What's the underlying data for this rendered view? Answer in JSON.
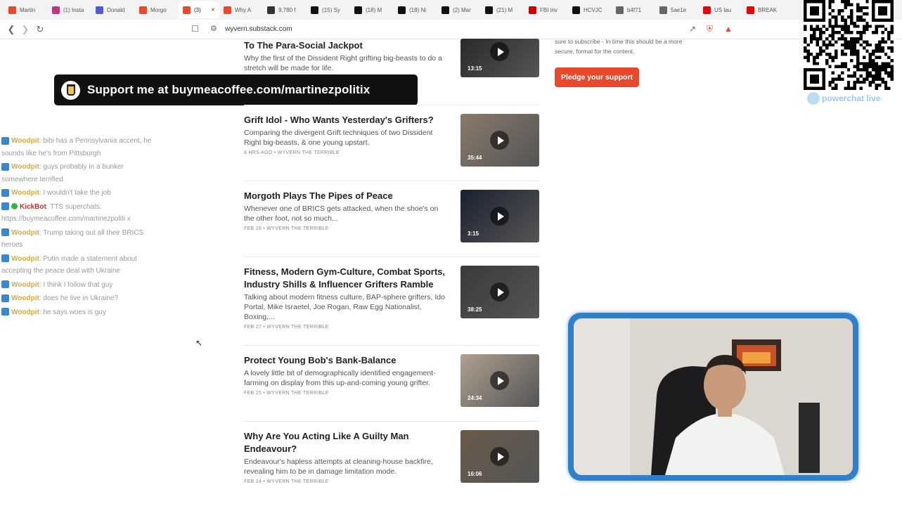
{
  "tabs": [
    {
      "label": "Martin",
      "color": "#e8492c"
    },
    {
      "label": "(1) Insta",
      "color": "#c13584"
    },
    {
      "label": "Donald",
      "color": "#4c5cd4"
    },
    {
      "label": "Morgo",
      "color": "#e8492c"
    },
    {
      "label": "(3)",
      "color": "#e8492c",
      "active": true
    },
    {
      "label": "Why A",
      "color": "#e8492c"
    },
    {
      "label": "9,780 f",
      "color": "#333"
    },
    {
      "label": "(15) Sy",
      "color": "#111"
    },
    {
      "label": "(18) M",
      "color": "#111"
    },
    {
      "label": "(18) Ni",
      "color": "#111"
    },
    {
      "label": "(2) Mar",
      "color": "#111"
    },
    {
      "label": "(21) M",
      "color": "#111"
    },
    {
      "label": "FBI inv",
      "color": "#cc0000"
    },
    {
      "label": "HCVJC",
      "color": "#111"
    },
    {
      "label": "b4f71",
      "color": "#666"
    },
    {
      "label": "5ae1e",
      "color": "#666"
    },
    {
      "label": "US lau",
      "color": "#e00"
    },
    {
      "label": "BREAK",
      "color": "#e00"
    }
  ],
  "address": {
    "url": "wyvern.substack.com"
  },
  "banner": {
    "text": "Support me at buymeacoffee.com/martinezpolitix"
  },
  "overlay_logo": {
    "text": "powerchat live"
  },
  "chat": [
    {
      "user": "Woodpit",
      "text": ": bibi has a Pennsylvania accent, he sounds like he's from Pittsburgh"
    },
    {
      "user": "Woodpit",
      "text": ": guys probably in a bunker somewhere terrified"
    },
    {
      "user": "Woodpit",
      "text": ": I wouldn't take the job"
    },
    {
      "user": "KickBot",
      "text": ": TTS superchats: https://buymeacoffee.com/martinezpoliti x",
      "bot": true
    },
    {
      "user": "Woodpit",
      "text": ": Trump taking out all their BRICS heroes"
    },
    {
      "user": "Woodpit",
      "text": ": Putin made a statement about accepting the peace deal with Ukraine"
    },
    {
      "user": "Woodpit",
      "text": ": I think I follow that guy"
    },
    {
      "user": "Woodpit",
      "text": ": does he live in Ukraine?"
    },
    {
      "user": "Woodpit",
      "text": ": he says woes is guy"
    }
  ],
  "posts": [
    {
      "title": "To The Para-Social Jackpot",
      "desc": "Why the first of the Dissident Right grifting big-beasts to do a stretch will be made for life.",
      "meta": "",
      "duration": "13:15"
    },
    {
      "title": "Grift Idol - Who Wants Yesterday's Grifters?",
      "desc": "Comparing the divergent Grift techniques of two Dissident Right big-beasts, & one young upstart.",
      "meta": "8 HRS AGO • WYVERN THE TERRIBLE",
      "duration": "35:44"
    },
    {
      "title": "Morgoth Plays The Pipes of Peace",
      "desc": "Whenever one of BRICS gets attacked, when the shoe's on the other foot, not so much...",
      "meta": "FEB 28 • WYVERN THE TERRIBLE",
      "duration": "3:15"
    },
    {
      "title": "Fitness, Modern Gym-Culture, Combat Sports, Industry Shills & Influencer Grifters Ramble",
      "desc": "Talking about modern fitness culture, BAP-sphere grifters, Ido Portal, Mike Israetel, Joe Rogan, Raw Egg Nationalist, Boxing,...",
      "meta": "FEB 27 • WYVERN THE TERRIBLE",
      "duration": "38:25"
    },
    {
      "title": "Protect Young Bob's Bank-Balance",
      "desc": "A lovely little bit of demographically identified engagement-farming on display from this up-and-coming young grifter.",
      "meta": "FEB 25 • WYVERN THE TERRIBLE",
      "duration": "24:34"
    },
    {
      "title": "Why Are You Acting Like A Guilty Man Endeavour?",
      "desc": "Endeavour's hapless attempts at cleaning-house backfire, revealing him to be in damage limitation mode.",
      "meta": "FEB 24 • WYVERN THE TERRIBLE",
      "duration": "16:06"
    }
  ],
  "sidebar": {
    "subscribe_text": "sure to subscribe - In time this should be a more secure, format for the content.",
    "pledge_label": "Pledge your support"
  },
  "colors": {
    "accent": "#e8492c",
    "chat_user": "#d4a94a",
    "bot_user": "#c53030",
    "webcam_frame": "#2f7fc9"
  }
}
